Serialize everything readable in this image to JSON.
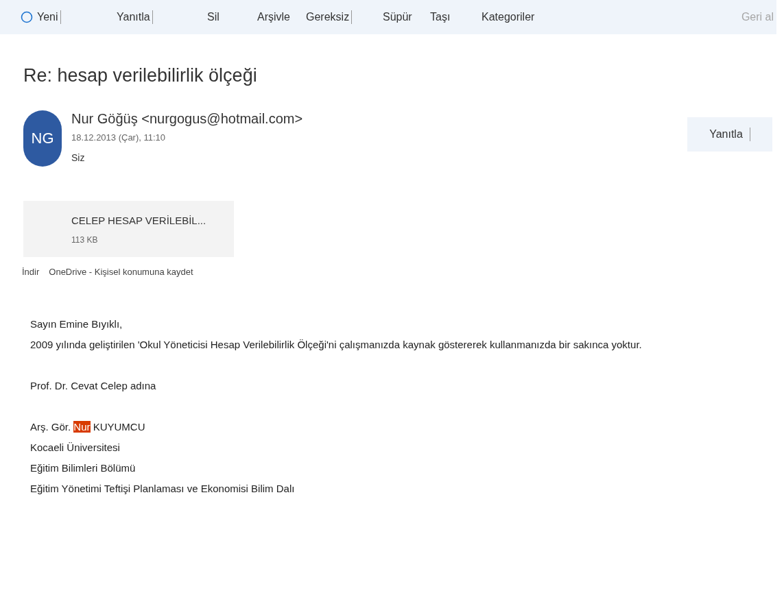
{
  "toolbar": {
    "items": [
      {
        "label": "Yeni",
        "kind": "new",
        "divider": true
      },
      {
        "label": "Yanıtla",
        "kind": "plain",
        "divider": true
      },
      {
        "label": "Sil",
        "kind": "plain",
        "divider": false
      },
      {
        "label": "Arşivle",
        "kind": "plain",
        "divider": false
      },
      {
        "label": "Gereksiz",
        "kind": "plain",
        "divider": true
      },
      {
        "label": "Süpür",
        "kind": "plain",
        "divider": false
      },
      {
        "label": "Taşı",
        "kind": "plain",
        "divider": false
      },
      {
        "label": "Kategoriler",
        "kind": "plain",
        "divider": false
      }
    ],
    "undo": {
      "label": "Geri al",
      "disabled": true
    }
  },
  "message": {
    "subject": "Re: hesap verilebilirlik ölçeği",
    "sender": {
      "initials": "NG",
      "name": "Nur Göğüş <nurgogus@hotmail.com>",
      "date": "18.12.2013 (Çar), 11:10",
      "to": "Siz"
    },
    "reply_button": {
      "label": "Yanıtla"
    },
    "attachment": {
      "name": "CELEP HESAP VERİLEBİL...",
      "size": "113 KB"
    },
    "attachment_links": [
      "İndir",
      "OneDrive - Kişisel konumuna kaydet"
    ],
    "body": [
      {
        "kind": "line",
        "segments": [
          {
            "text": "Sayın Emine Bıyıklı,",
            "highlighted": false
          }
        ]
      },
      {
        "kind": "line",
        "segments": [
          {
            "text": "2009 yılında geliştirilen 'Okul Yöneticisi Hesap Verilebilirlik Ölçeği'ni çalışmanızda kaynak göstererek kullanmanızda bir sakınca yoktur.",
            "highlighted": false
          }
        ]
      },
      {
        "kind": "blank"
      },
      {
        "kind": "line",
        "segments": [
          {
            "text": "Prof. Dr. Cevat Celep adına",
            "highlighted": false
          }
        ]
      },
      {
        "kind": "blank"
      },
      {
        "kind": "line",
        "segments": [
          {
            "text": "Arş. Gör. ",
            "highlighted": false
          },
          {
            "text": "Nur",
            "highlighted": true
          },
          {
            "text": " KUYUMCU",
            "highlighted": false
          }
        ]
      },
      {
        "kind": "line",
        "segments": [
          {
            "text": "Kocaeli Üniversitesi",
            "highlighted": false
          }
        ]
      },
      {
        "kind": "line",
        "segments": [
          {
            "text": "Eğitim Bilimleri Bölümü",
            "highlighted": false
          }
        ]
      },
      {
        "kind": "line",
        "segments": [
          {
            "text": "Eğitim Yönetimi Teftişi Planlaması ve Ekonomisi Bilim Dalı",
            "highlighted": false
          }
        ]
      }
    ]
  }
}
